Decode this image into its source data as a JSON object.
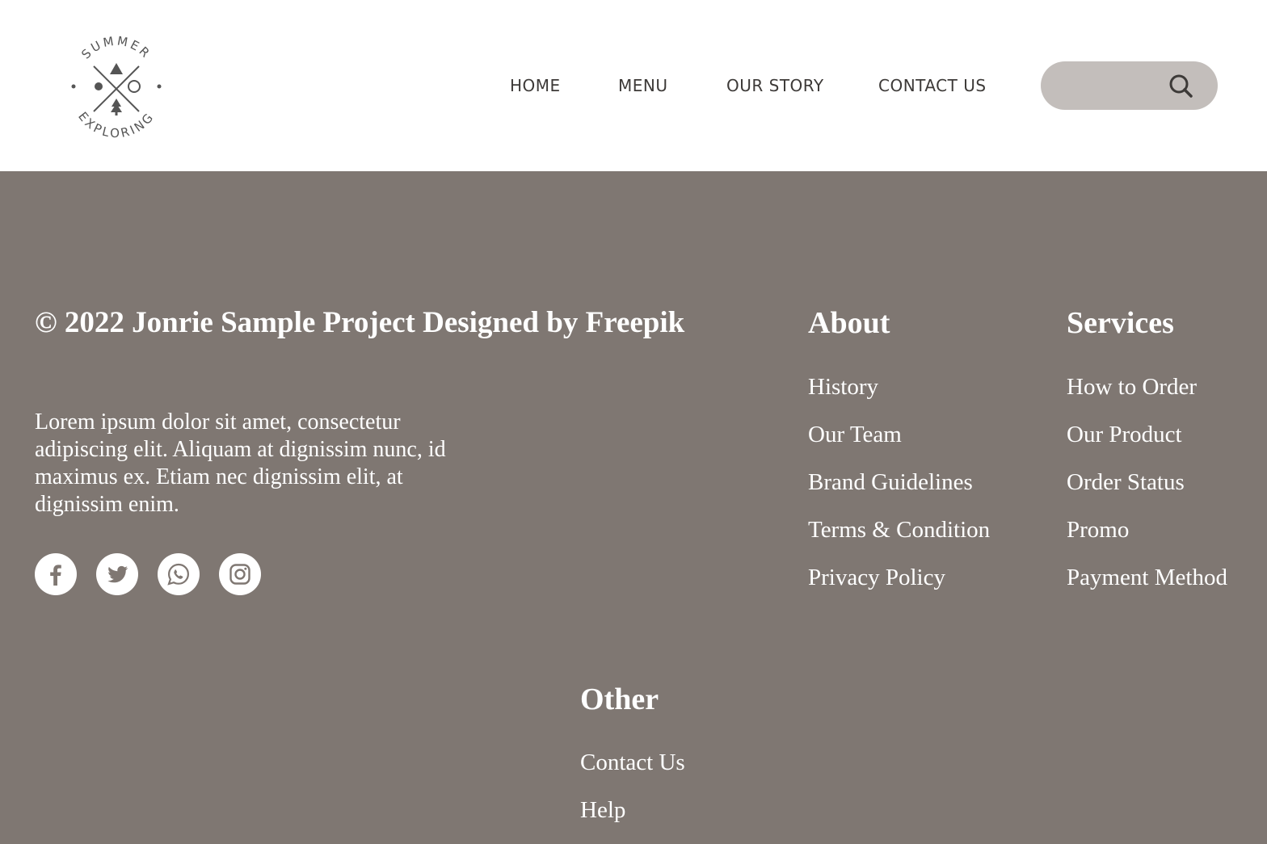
{
  "logo": {
    "arc_top": "SUMMER",
    "arc_bottom": "EXPLORING"
  },
  "nav": {
    "items": [
      "HOME",
      "MENU",
      "OUR STORY",
      "CONTACT US"
    ]
  },
  "search": {
    "value": "",
    "placeholder": "",
    "icon": "search-icon"
  },
  "footer": {
    "copyright": "© 2022 Jonrie Sample Project Designed by Freepik",
    "blurb": "Lorem ipsum dolor sit amet, consectetur adipiscing elit. Aliquam at dignissim nunc, id maximus ex. Etiam nec dignissim elit, at dignissim enim.",
    "socials": [
      "facebook-icon",
      "twitter-icon",
      "whatsapp-icon",
      "instagram-icon"
    ],
    "about": {
      "title": "About",
      "links": [
        "History",
        "Our Team",
        "Brand Guidelines",
        "Terms & Condition",
        "Privacy Policy"
      ]
    },
    "services": {
      "title": "Services",
      "links": [
        "How to Order",
        "Our Product",
        "Order Status",
        "Promo",
        "Payment Method"
      ]
    },
    "other": {
      "title": "Other",
      "links": [
        "Contact Us",
        "Help"
      ]
    }
  },
  "colors": {
    "footer_bg": "#7f7772",
    "header_bg": "#ffffff",
    "search_bg": "#c3bebb",
    "nav_text": "#3d3a38"
  }
}
